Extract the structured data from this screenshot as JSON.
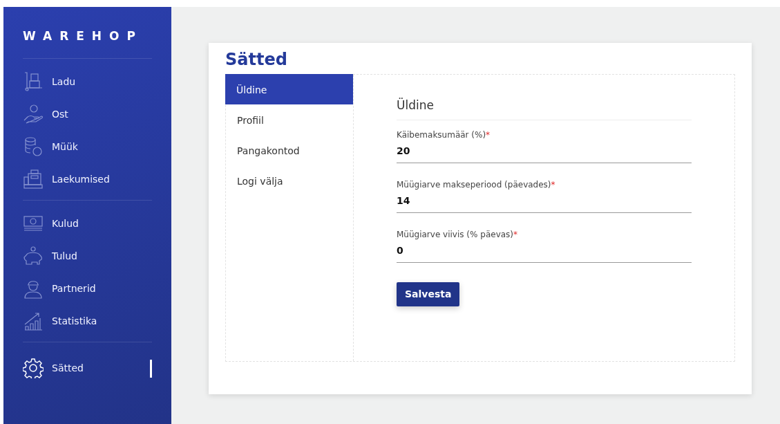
{
  "brand": "WAREHOP",
  "sidebar": {
    "groups": [
      {
        "items": [
          {
            "label": "Ladu",
            "selected": false
          },
          {
            "label": "Ost",
            "selected": false
          },
          {
            "label": "Müük",
            "selected": false
          },
          {
            "label": "Laekumised",
            "selected": false
          }
        ]
      },
      {
        "items": [
          {
            "label": "Kulud",
            "selected": false
          },
          {
            "label": "Tulud",
            "selected": false
          },
          {
            "label": "Partnerid",
            "selected": false
          },
          {
            "label": "Statistika",
            "selected": false
          }
        ]
      },
      {
        "items": [
          {
            "label": "Sätted",
            "selected": true
          }
        ]
      }
    ]
  },
  "page_title": "Sätted",
  "tabs": [
    {
      "label": "Üldine",
      "selected": true
    },
    {
      "label": "Profiil",
      "selected": false
    },
    {
      "label": "Pangakontod",
      "selected": false
    },
    {
      "label": "Logi välja",
      "selected": false
    }
  ],
  "section_title": "Üldine",
  "fields": [
    {
      "label": "Käibemaksumäär (%)",
      "required_mark": "*",
      "value": "20"
    },
    {
      "label": "Müügiarve makseperiood (päevades)",
      "required_mark": "*",
      "value": "14"
    },
    {
      "label": "Müügiarve viivis (% päevas)",
      "required_mark": "*",
      "value": "0"
    }
  ],
  "save_button": "Salvesta"
}
